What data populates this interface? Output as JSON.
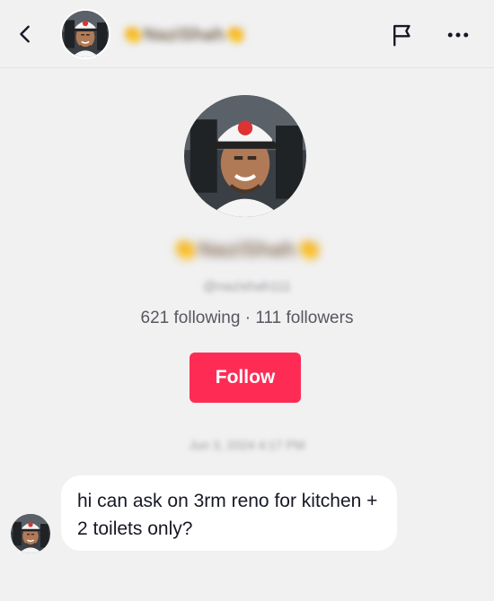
{
  "header": {
    "name": "👏NaziShah👏",
    "back_icon": "chevron-left-icon",
    "flag_icon": "flag-icon",
    "more_icon": "ellipsis-horizontal-icon"
  },
  "profile": {
    "display_name": "👏NaziShah👏",
    "username": "@nazishah111",
    "stats": "621 following · 111 followers",
    "follow_label": "Follow"
  },
  "conversation": {
    "timestamp": "Jun 3, 2024 4:17 PM",
    "messages": [
      {
        "text": "hi can ask on 3rm reno for kitchen + 2 toilets only?"
      }
    ]
  },
  "colors": {
    "accent": "#fe2c55",
    "background": "#f1f1f2",
    "bubble": "#ffffff"
  }
}
